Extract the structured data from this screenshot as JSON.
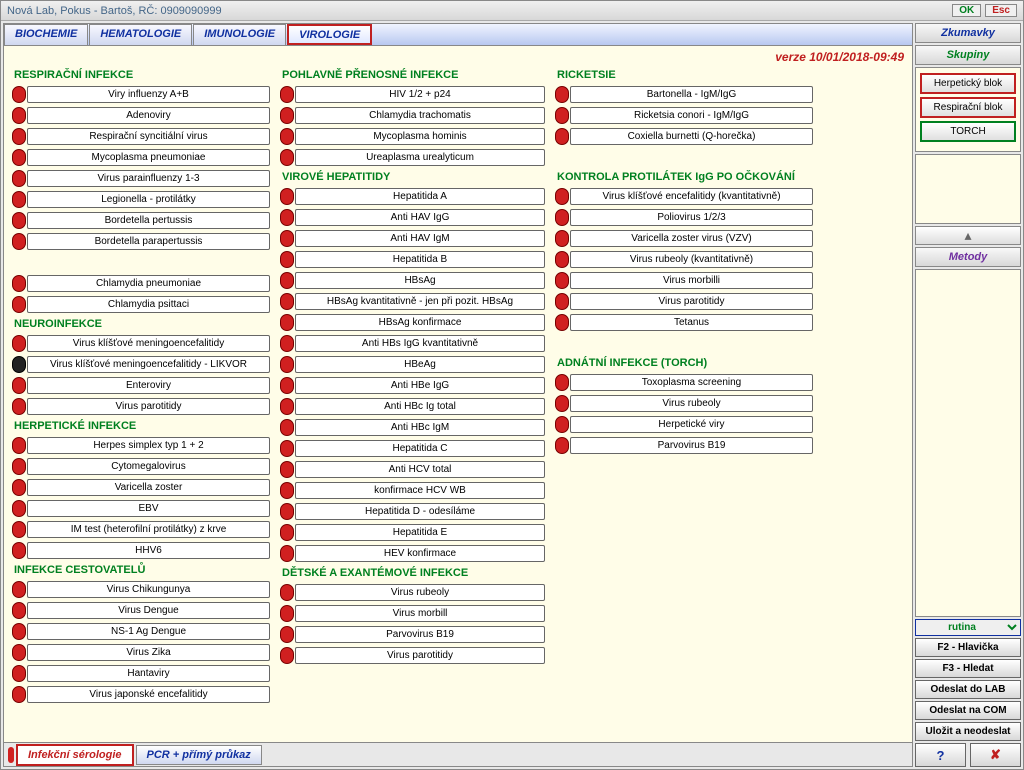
{
  "title": "Nová  Lab,   Pokus  - Bartoš, RČ: 0909090999",
  "titlebar": {
    "ok": "OK",
    "esc": "Esc"
  },
  "tabs": {
    "t1": "BIOCHEMIE",
    "t2": "HEMATOLOGIE",
    "t3": "IMUNOLOGIE",
    "t4": "VIROLOGIE"
  },
  "version": "verze 10/01/2018-09:49",
  "sections": {
    "resp": "RESPIRAČNÍ INFEKCE",
    "neuro": "NEUROINFEKCE",
    "herp": "HERPETICKÉ INFEKCE",
    "travel": "INFEKCE CESTOVATELŮ",
    "std": "POHLAVNĚ PŘENOSNÉ INFEKCE",
    "vhep": "VIROVÉ HEPATITIDY",
    "child": "DĚTSKÉ A EXANTÉMOVÉ INFEKCE",
    "rick": "RICKETSIE",
    "vacc": "KONTROLA PROTILÁTEK IgG PO OČKOVÁNÍ",
    "torch": "ADNÁTNÍ INFEKCE (TORCH)"
  },
  "tests": {
    "r1": "Viry influenzy A+B",
    "r2": "Adenoviry",
    "r3": "Respirační syncitiální virus",
    "r4": "Mycoplasma pneumoniae",
    "r5": "Virus parainfluenzy 1-3",
    "r6": "Legionella - protilátky",
    "r7": "Bordetella pertussis",
    "r8": "Bordetella parapertussis",
    "r9": "Chlamydia pneumoniae",
    "r10": "Chlamydia psittaci",
    "n1": "Virus klíšťové meningoencefalitidy",
    "n2": "Virus klíšťové meningoencefalitidy - LIKVOR",
    "n3": "Enteroviry",
    "n4": "Virus parotitidy",
    "h1": "Herpes simplex typ 1 + 2",
    "h2": "Cytomegalovirus",
    "h3": "Varicella zoster",
    "h4": "EBV",
    "h5": "IM test (heterofilní protilátky) z krve",
    "h6": "HHV6",
    "tr1": "Virus Chikungunya",
    "tr2": "Virus Dengue",
    "tr3": "NS-1 Ag Dengue",
    "tr4": "Virus Zika",
    "tr5": "Hantaviry",
    "tr6": "Virus japonské encefalitidy",
    "s1": "HIV 1/2 + p24",
    "s2": "Chlamydia trachomatis",
    "s3": "Mycoplasma hominis",
    "s4": "Ureaplasma urealyticum",
    "v1": "Hepatitida A",
    "v2": "Anti HAV IgG",
    "v3": "Anti HAV IgM",
    "v4": "Hepatitida B",
    "v5": "HBsAg",
    "v6": "HBsAg kvantitativně - jen při pozit. HBsAg",
    "v7": "HBsAg konfirmace",
    "v8": "Anti HBs IgG kvantitativně",
    "v9": "HBeAg",
    "v10": "Anti HBe IgG",
    "v11": "Anti HBc Ig total",
    "v12": "Anti HBc IgM",
    "v13": "Hepatitida C",
    "v14": "Anti HCV total",
    "v15": "konfirmace HCV WB",
    "v16": "Hepatitida D - odesíláme",
    "v17": "Hepatitida E",
    "v18": "HEV konfirmace",
    "c1": "Virus rubeoly",
    "c2": "Virus morbill",
    "c3": "Parvovirus B19",
    "c4": "Virus parotitidy",
    "rk1": "Bartonella - IgM/IgG",
    "rk2": "Ricketsia conori - IgM/IgG",
    "rk3": "Coxiella burnetti (Q-horečka)",
    "va1": "Virus klíšťové encefalitidy (kvantitativně)",
    "va2": "Poliovirus 1/2/3",
    "va3": "Varicella zoster virus (VZV)",
    "va4": "Virus rubeoly (kvantitativně)",
    "va5": "Virus morbilli",
    "va6": "Virus parotitidy",
    "va7": "Tetanus",
    "to1": "Toxoplasma screening",
    "to2": "Virus rubeoly",
    "to3": "Herpetické viry",
    "to4": "Parvovirus B19"
  },
  "bottomtabs": {
    "b1": "Infekční sérologie",
    "b2": "PCR + přímý průkaz"
  },
  "right": {
    "zkumavky": "Zkumavky",
    "skupiny": "Skupiny",
    "g1": "Herpetický blok",
    "g2": "Respirační blok",
    "g3": "TORCH",
    "metody": "Metody",
    "combo": "rutina",
    "f2": "F2 - Hlavička",
    "f3": "F3 - Hledat",
    "lab": "Odeslat do LAB",
    "com": "Odeslat na COM",
    "save": "Uložit a neodeslat",
    "help": "?",
    "cancel": "✘"
  }
}
